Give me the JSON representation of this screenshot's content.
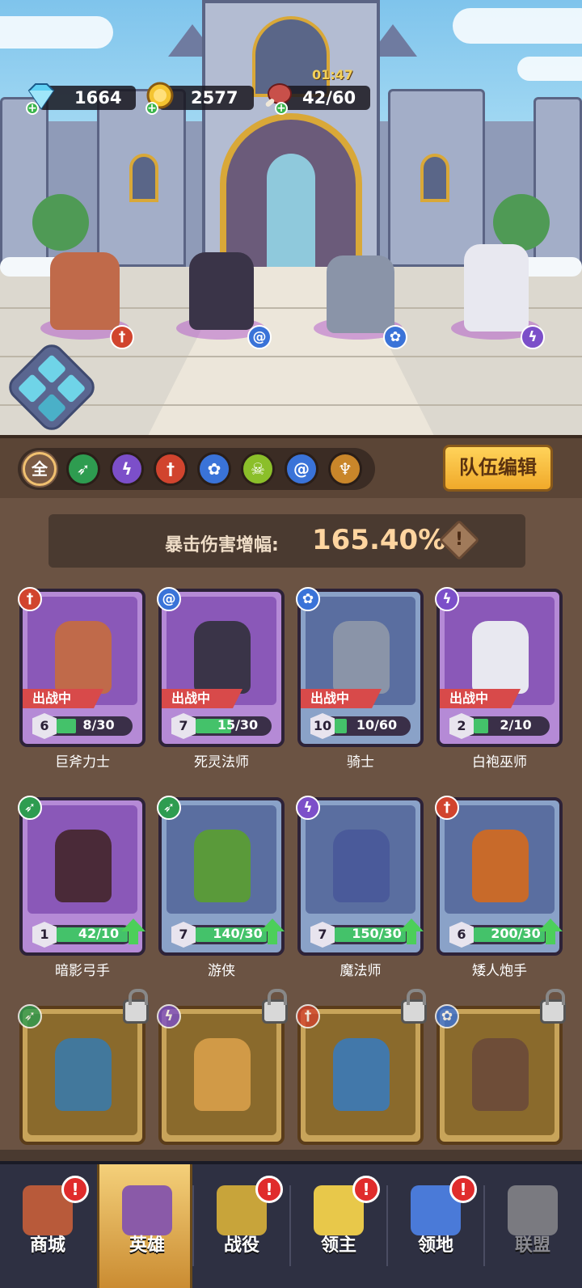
{
  "resources": {
    "gems": "1664",
    "gold": "2577",
    "stamina": "42/60",
    "stamina_timer": "01:47"
  },
  "scene_heroes": [
    {
      "name": "巨斧力士",
      "class_icon": "sword-icon",
      "class_color": "#d1442e",
      "class_glyph": "†"
    },
    {
      "name": "死灵法师",
      "class_icon": "spiral-icon",
      "class_color": "#3a73d8",
      "class_glyph": "@"
    },
    {
      "name": "骑士",
      "class_icon": "paw-icon",
      "class_color": "#3a73d8",
      "class_glyph": "✿"
    },
    {
      "name": "白袍巫师",
      "class_icon": "staff-icon",
      "class_color": "#7c4fc9",
      "class_glyph": "ϟ"
    }
  ],
  "filters": [
    {
      "id": "all",
      "label": "全",
      "icon": "all-filter",
      "color": "#7a5a44"
    },
    {
      "id": "archer",
      "label": "",
      "icon": "bow-icon",
      "color": "#2e9c50",
      "glyph": "➶"
    },
    {
      "id": "mage",
      "label": "",
      "icon": "staff-icon",
      "color": "#7c4fc9",
      "glyph": "ϟ"
    },
    {
      "id": "warrior",
      "label": "",
      "icon": "sword-icon",
      "color": "#d1442e",
      "glyph": "†"
    },
    {
      "id": "beast",
      "label": "",
      "icon": "paw-icon",
      "color": "#3a73d8",
      "glyph": "✿"
    },
    {
      "id": "undead",
      "label": "",
      "icon": "skull-icon",
      "color": "#8bbf2a",
      "glyph": "☠"
    },
    {
      "id": "arcane",
      "label": "",
      "icon": "spiral-icon",
      "color": "#3a73d8",
      "glyph": "@"
    },
    {
      "id": "holy",
      "label": "",
      "icon": "wings-icon",
      "color": "#c9862a",
      "glyph": "♆"
    }
  ],
  "team_edit_label": "队伍编辑",
  "crit": {
    "label": "暴击伤害增幅:",
    "value": "165.40%"
  },
  "heroes_owned": [
    {
      "name": "巨斧力士",
      "level": "6",
      "progress": "8/30",
      "progress_ratio": 0.27,
      "in_battle": true,
      "status_label": "出战中",
      "rarity": "purple",
      "class_color": "#d1442e",
      "class_glyph": "†",
      "upgradable": false,
      "body_color": "#c06a4a"
    },
    {
      "name": "死灵法师",
      "level": "7",
      "progress": "15/30",
      "progress_ratio": 0.5,
      "in_battle": true,
      "status_label": "出战中",
      "rarity": "purple",
      "class_color": "#3a73d8",
      "class_glyph": "@",
      "upgradable": false,
      "body_color": "#3a3448"
    },
    {
      "name": "骑士",
      "level": "10",
      "progress": "10/60",
      "progress_ratio": 0.17,
      "in_battle": true,
      "status_label": "出战中",
      "rarity": "blue",
      "class_color": "#3a73d8",
      "class_glyph": "✿",
      "upgradable": false,
      "body_color": "#8a94a8"
    },
    {
      "name": "白袍巫师",
      "level": "2",
      "progress": "2/10",
      "progress_ratio": 0.2,
      "in_battle": true,
      "status_label": "出战中",
      "rarity": "purple",
      "class_color": "#7c4fc9",
      "class_glyph": "ϟ",
      "upgradable": false,
      "body_color": "#e8e8f0"
    },
    {
      "name": "暗影弓手",
      "level": "1",
      "progress": "42/10",
      "progress_ratio": 1,
      "in_battle": false,
      "status_label": "",
      "rarity": "purple",
      "class_color": "#2e9c50",
      "class_glyph": "➶",
      "upgradable": true,
      "body_color": "#4a2a38"
    },
    {
      "name": "游侠",
      "level": "7",
      "progress": "140/30",
      "progress_ratio": 1,
      "in_battle": false,
      "status_label": "",
      "rarity": "blue",
      "class_color": "#2e9c50",
      "class_glyph": "➶",
      "upgradable": true,
      "body_color": "#5a9a3a"
    },
    {
      "name": "魔法师",
      "level": "7",
      "progress": "150/30",
      "progress_ratio": 1,
      "in_battle": false,
      "status_label": "",
      "rarity": "blue",
      "class_color": "#7c4fc9",
      "class_glyph": "ϟ",
      "upgradable": true,
      "body_color": "#4a5a9a"
    },
    {
      "name": "矮人炮手",
      "level": "6",
      "progress": "200/30",
      "progress_ratio": 1,
      "in_battle": false,
      "status_label": "",
      "rarity": "blue",
      "class_color": "#d1442e",
      "class_glyph": "†",
      "upgradable": true,
      "body_color": "#c86a2a"
    }
  ],
  "heroes_locked": [
    {
      "class_color": "#2e9c50",
      "class_glyph": "➶",
      "body_color": "#3a7aa8"
    },
    {
      "class_color": "#7c4fc9",
      "class_glyph": "ϟ",
      "body_color": "#d8a04a"
    },
    {
      "class_color": "#d1442e",
      "class_glyph": "†",
      "body_color": "#3a7ab8"
    },
    {
      "class_color": "#3a73d8",
      "class_glyph": "✿",
      "body_color": "#6a4a3a"
    }
  ],
  "nav": [
    {
      "id": "shop",
      "label": "商城",
      "icon": "chest-icon",
      "alert": true,
      "active": false,
      "disabled": false,
      "color": "#b85a3a"
    },
    {
      "id": "heroes",
      "label": "英雄",
      "icon": "cards-icon",
      "alert": false,
      "active": true,
      "disabled": false,
      "color": "#8a5aa8"
    },
    {
      "id": "campaign",
      "label": "战役",
      "icon": "crossed-swords-icon",
      "alert": true,
      "active": false,
      "disabled": false,
      "color": "#c8a43a"
    },
    {
      "id": "lord",
      "label": "领主",
      "icon": "crown-icon",
      "alert": true,
      "active": false,
      "disabled": false,
      "color": "#e8c84a"
    },
    {
      "id": "territory",
      "label": "领地",
      "icon": "castle-icon",
      "alert": true,
      "active": false,
      "disabled": false,
      "color": "#4a7ad8"
    },
    {
      "id": "alliance",
      "label": "联盟",
      "icon": "helmet-icon",
      "alert": false,
      "active": false,
      "disabled": true,
      "color": "#7a7a80"
    }
  ]
}
